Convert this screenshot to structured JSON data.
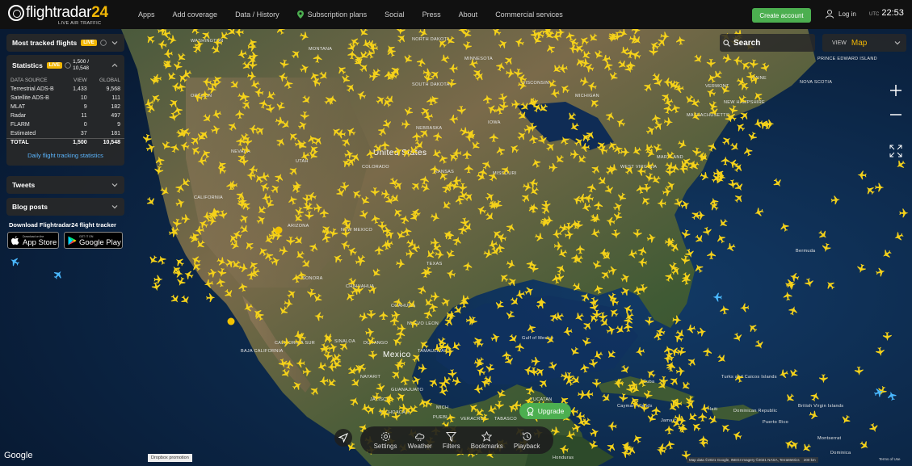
{
  "logo": {
    "name": "flightradar",
    "accent": "24",
    "subtitle": "LIVE AIR TRAFFIC"
  },
  "nav": {
    "items": [
      "Apps",
      "Add coverage",
      "Data / History",
      "Subscription plans",
      "Social",
      "Press",
      "About",
      "Commercial services"
    ]
  },
  "header": {
    "create_account": "Create account",
    "login": "Log in",
    "tz": "UTC",
    "time": "22:53"
  },
  "panels": {
    "most_tracked": {
      "title": "Most tracked flights",
      "live": "LIVE"
    },
    "statistics": {
      "title": "Statistics",
      "live": "LIVE",
      "count": "1,500 /",
      "count2": "10,548",
      "headers": [
        "DATA SOURCE",
        "VIEW",
        "GLOBAL"
      ],
      "rows": [
        [
          "Terrestrial ADS-B",
          "1,433",
          "9,568"
        ],
        [
          "Satellite ADS-B",
          "10",
          "111"
        ],
        [
          "MLAT",
          "9",
          "182"
        ],
        [
          "Radar",
          "11",
          "497"
        ],
        [
          "FLARM",
          "0",
          "9"
        ],
        [
          "Estimated",
          "37",
          "181"
        ]
      ],
      "total": [
        "TOTAL",
        "1,500",
        "10,548"
      ],
      "link": "Daily flight tracking statistics"
    },
    "tweets": {
      "title": "Tweets"
    },
    "blog": {
      "title": "Blog posts"
    }
  },
  "download": {
    "title": "Download Flightradar24 flight tracker",
    "appstore_small": "Download on the",
    "appstore_big": "App Store",
    "googleplay_small": "GET IT ON",
    "googleplay_big": "Google Play"
  },
  "controls": {
    "search": "Search",
    "view_label": "VIEW",
    "view_value": "Map"
  },
  "toolbar": {
    "items": [
      "Settings",
      "Weather",
      "Filters",
      "Bookmarks",
      "Playback"
    ],
    "upgrade": "Upgrade"
  },
  "map_labels": [
    {
      "text": "WASHINGTON"
    },
    {
      "text": "MONTANA"
    },
    {
      "text": "NORTH DAKOTA"
    },
    {
      "text": "MINNESOTA"
    },
    {
      "text": "SOUTH DAKOTA"
    },
    {
      "text": "WISCONSIN"
    },
    {
      "text": "MICHIGAN"
    },
    {
      "text": "OREGON"
    },
    {
      "text": "VERMONT"
    },
    {
      "text": "MAINE"
    },
    {
      "text": "NEW HAMPSHIRE"
    },
    {
      "text": "MASSACHUSETTS"
    },
    {
      "text": "NOVA SCOTIA"
    },
    {
      "text": "PRINCE EDWARD ISLAND"
    },
    {
      "text": "NEBRASKA"
    },
    {
      "text": "IOWA"
    },
    {
      "text": "NEVADA"
    },
    {
      "text": "UTAH"
    },
    {
      "text": "United States"
    },
    {
      "text": "COLORADO"
    },
    {
      "text": "KANSAS"
    },
    {
      "text": "MISSOURI"
    },
    {
      "text": "WEST VIRGINIA"
    },
    {
      "text": "MARYLAND"
    },
    {
      "text": "CALIFORNIA"
    },
    {
      "text": "ARIZONA"
    },
    {
      "text": "NEW MEXICO"
    },
    {
      "text": "TEXAS"
    },
    {
      "text": "SONORA"
    },
    {
      "text": "CHIHUAHUA"
    },
    {
      "text": "COAHUILA"
    },
    {
      "text": "NUEVO LEON"
    },
    {
      "text": "Mexico"
    },
    {
      "text": "Gulf of Mexico"
    },
    {
      "text": "SINALOA"
    },
    {
      "text": "DURANGO"
    },
    {
      "text": "TAMAULIPAS"
    },
    {
      "text": "NAYARIT"
    },
    {
      "text": "JALISCO"
    },
    {
      "text": "GUANAJUATO"
    },
    {
      "text": "MICHOACAN"
    },
    {
      "text": "PUEBLA"
    },
    {
      "text": "VERACRUZ"
    },
    {
      "text": "TABASCO"
    },
    {
      "text": "YUCATAN"
    },
    {
      "text": "Cuba"
    },
    {
      "text": "Bermuda"
    },
    {
      "text": "Haiti"
    },
    {
      "text": "Dominican Republic"
    },
    {
      "text": "Puerto Rico"
    },
    {
      "text": "Jamaica"
    },
    {
      "text": "Cayman Islands"
    },
    {
      "text": "Turks and Caicos Islands"
    },
    {
      "text": "British Virgin Islands"
    },
    {
      "text": "Montserrat"
    },
    {
      "text": "Dominica"
    },
    {
      "text": "Honduras"
    },
    {
      "text": "CALIFORNIA SUR"
    },
    {
      "text": "BAJA CALIFORNIA"
    },
    {
      "text": "MICH"
    }
  ],
  "footer": {
    "google": "Google",
    "dropbox": "Dropbox promotion",
    "attribution": "Map data ©2021 Google, INEGI Imagery ©2021 NASA, TerraMetrics",
    "scale": "200 km",
    "terms": "Terms of Use"
  },
  "colors": {
    "accent": "#f2b705",
    "upgrade_green": "#4caf50",
    "aircraft": "#f5d21a",
    "link": "#5bb6ff"
  }
}
